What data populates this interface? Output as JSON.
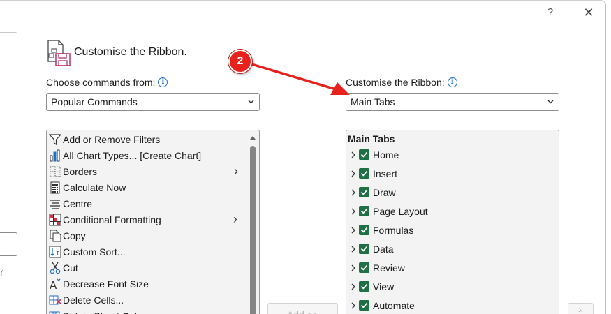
{
  "window": {
    "help_glyph": "?",
    "close_glyph": "✕"
  },
  "nav": {
    "partial_text": "r"
  },
  "header": {
    "title": "Customise the Ribbon."
  },
  "left": {
    "label_accel": "C",
    "label_rest": "hoose commands from:",
    "select_value": "Popular Commands",
    "commands": [
      {
        "icon": "filter-icon",
        "label": "Add or Remove Filters"
      },
      {
        "icon": "chart-icon",
        "label": "All Chart Types... [Create Chart]"
      },
      {
        "icon": "borders-icon",
        "label": "Borders"
      },
      {
        "icon": "calculator-icon",
        "label": "Calculate Now"
      },
      {
        "icon": "align-center-icon",
        "label": "Centre"
      },
      {
        "icon": "conditional-formatting-icon",
        "label": "Conditional Formatting"
      },
      {
        "icon": "copy-icon",
        "label": "Copy"
      },
      {
        "icon": "sort-icon",
        "label": "Custom Sort..."
      },
      {
        "icon": "scissors-icon",
        "label": "Cut"
      },
      {
        "icon": "font-size-decrease-icon",
        "label": "Decrease Font Size"
      },
      {
        "icon": "delete-cells-icon",
        "label": "Delete Cells..."
      },
      {
        "icon": "delete-column-icon",
        "label": "Delete Sheet Columns"
      }
    ]
  },
  "right": {
    "label_pre": "Customise the Ri",
    "label_accel": "b",
    "label_post": "bon:",
    "select_value": "Main Tabs",
    "list_header": "Main Tabs",
    "tabs": [
      {
        "label": "Home",
        "checked": true
      },
      {
        "label": "Insert",
        "checked": true
      },
      {
        "label": "Draw",
        "checked": true
      },
      {
        "label": "Page Layout",
        "checked": true
      },
      {
        "label": "Formulas",
        "checked": true
      },
      {
        "label": "Data",
        "checked": true
      },
      {
        "label": "Review",
        "checked": true
      },
      {
        "label": "View",
        "checked": true
      },
      {
        "label": "Automate",
        "checked": true
      }
    ]
  },
  "buttons": {
    "add_label": "Add >>"
  },
  "annotation": {
    "badge": "2"
  },
  "colors": {
    "accent_check": "#1f7145",
    "info_blue": "#1e6fc7",
    "annotation_red": "#e7221c"
  }
}
